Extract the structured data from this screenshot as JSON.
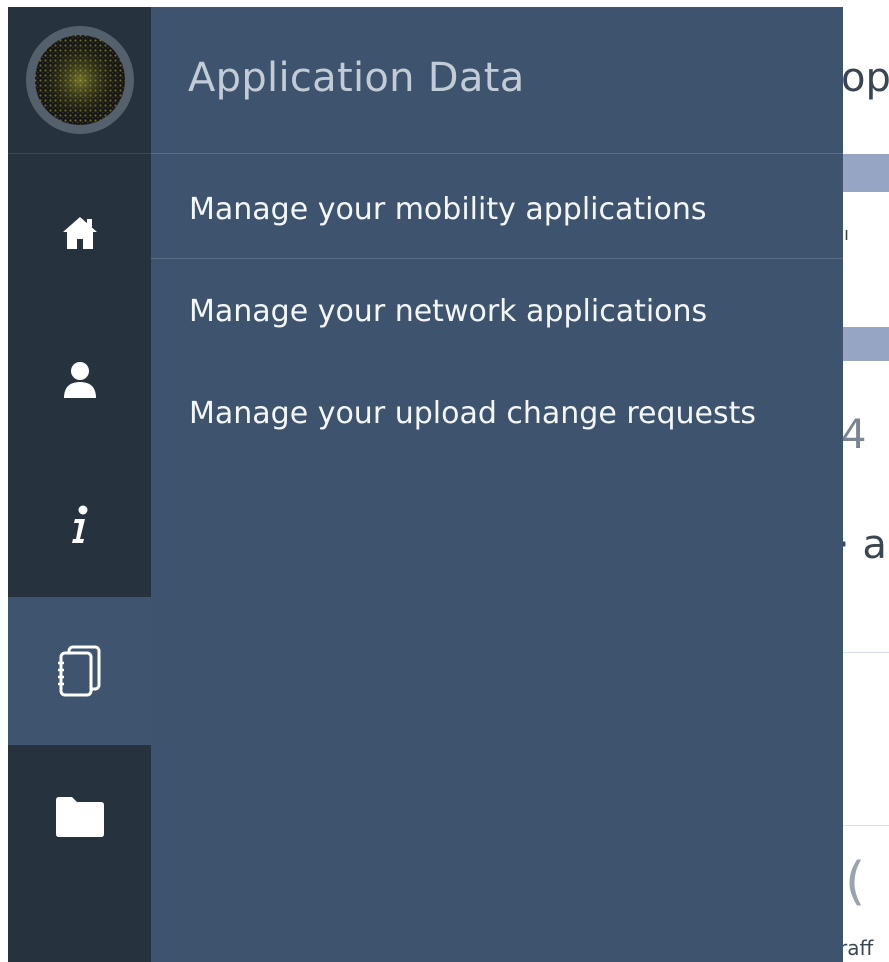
{
  "sidebar": {
    "avatar": "avatar",
    "items": [
      {
        "icon": "home-icon",
        "active": false
      },
      {
        "icon": "user-icon",
        "active": false
      },
      {
        "icon": "info-icon",
        "active": false
      },
      {
        "icon": "documents-icon",
        "active": true
      },
      {
        "icon": "folder-icon",
        "active": false
      }
    ]
  },
  "flyout": {
    "title": "Application Data",
    "links": [
      "Manage your mobility applications",
      "Manage your network applications",
      "Manage your upload change requests"
    ]
  },
  "background": {
    "heading_fragment": "op",
    "small_fragment": "ıı",
    "number_fragment": "4",
    "text_fragment": "· ar",
    "bottom_fragment": "raff",
    "circle_fragment": "("
  },
  "colors": {
    "rail": "#27323f",
    "rail_active": "#3e546f",
    "flyout": "#3e536d",
    "title_text": "#c2ccd7",
    "link_text": "#f4f7fa"
  }
}
